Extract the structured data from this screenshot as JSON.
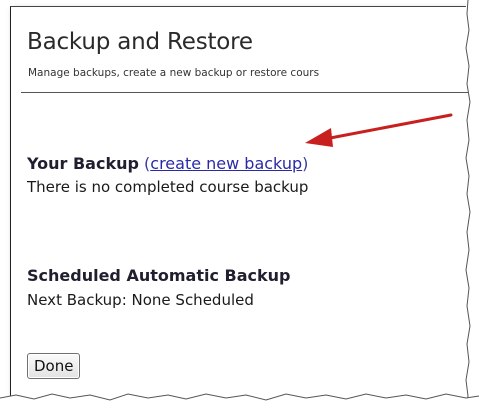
{
  "header": {
    "title": "Backup and Restore",
    "subtitle": "Manage backups, create a new backup or restore cours"
  },
  "your_backup": {
    "heading": "Your Backup",
    "paren_open": "(",
    "link_label": "create new backup",
    "paren_close": ")",
    "status": "There is no completed course backup"
  },
  "scheduled": {
    "heading": "Scheduled Automatic Backup",
    "next_backup": "Next Backup: None Scheduled"
  },
  "actions": {
    "done_label": "Done"
  },
  "colors": {
    "arrow": "#c81f1f",
    "link": "#2a2aa8"
  },
  "icons": [
    "red-arrow-annotation"
  ]
}
